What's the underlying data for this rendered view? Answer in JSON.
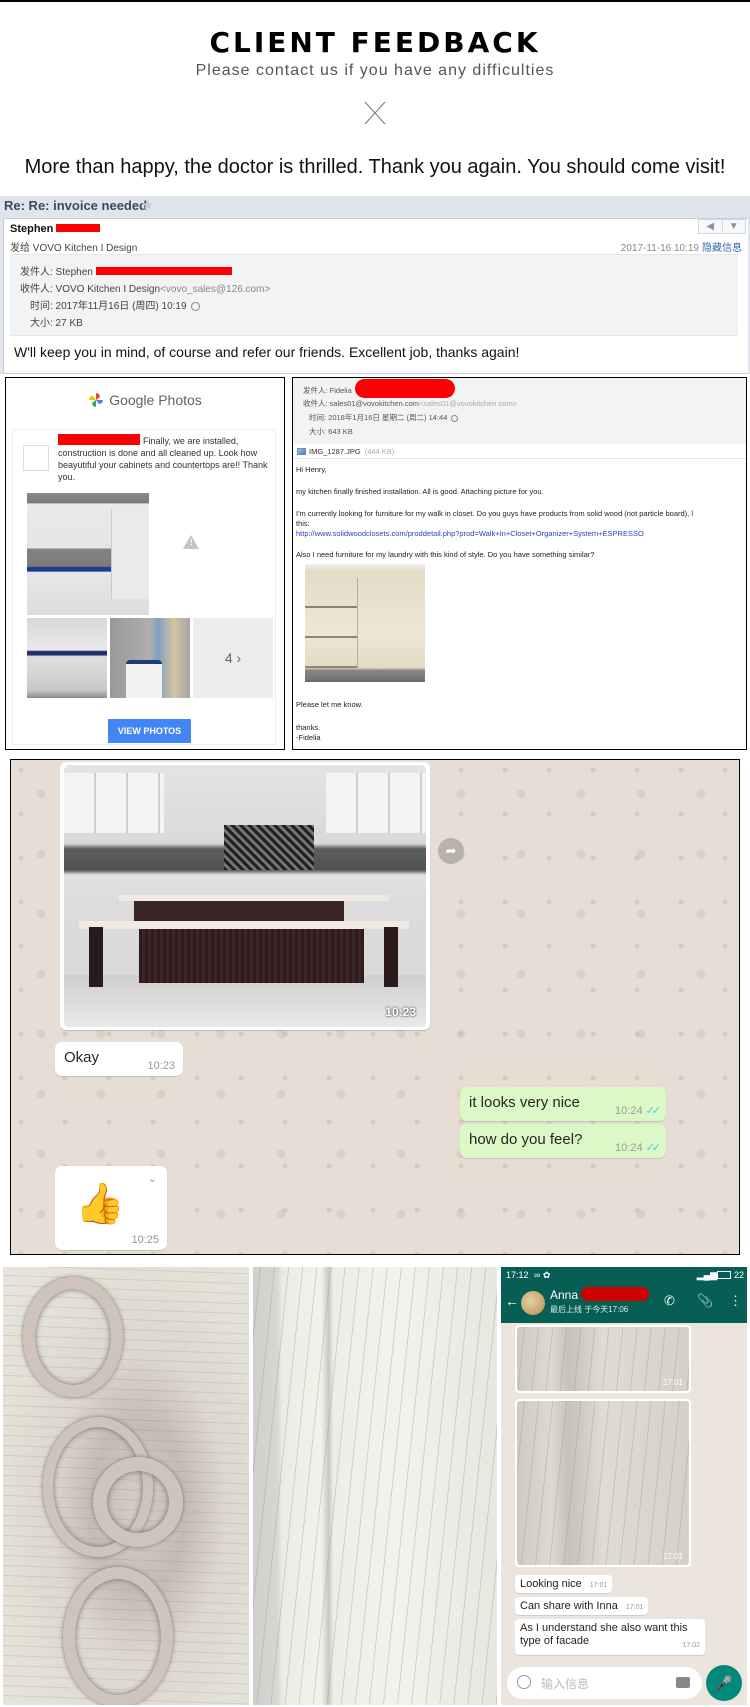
{
  "header": {
    "title": "CLIENT FEEDBACK",
    "subtitle": "Please contact us if you have any difficulties",
    "quote": "More than happy, the doctor is thrilled. Thank you again. You should come visit!"
  },
  "email1": {
    "subject": "Re: Re: invoice needed",
    "sender_name": "Stephen",
    "to_line": "发给 VOVO Kitchen I Design",
    "date": "2017-11-16 10:19",
    "hide_info_link": "隐藏信息",
    "from_label": "发件人: Stephen",
    "recipient_label": "收件人: VOVO Kitchen I Design",
    "recipient_email": "<vovo_sales@126.com>",
    "time_label": "时间: 2017年11月16日 (周四) 10:19",
    "size_label": "大小: 27 KB",
    "body": "W'll keep you in mind, of course and refer our friends.  Excellent job, thanks again!",
    "reply_icon": "reply-icon",
    "more_icon": "dropdown-icon"
  },
  "google_photos": {
    "brand": "Google Photos",
    "message": "Finally, we are installed, construction is done and all cleaned up. Look how beayutiful your cabinets and countertops are!! Thank you.",
    "more_count": "4 ›",
    "button_label": "VIEW PHOTOS"
  },
  "email2": {
    "from_label": "发件人: Fidelia",
    "recipient_label": "收件人: sales01@vovokitchen.com",
    "recipient_email": "<sales01@vovokitchen.com>",
    "time_label": "时间: 2018年1月16日 星期二 (周二) 14:44",
    "size_label": "大小: 643 KB",
    "attachment_name": "IMG_1287.JPG",
    "attachment_size": "(444 KB)",
    "greeting": "Hi Henry,",
    "p1": "my kitchen finally finished installation. All is good. Attaching picture for you.",
    "p2": "I'm currently looking for furniture for my walk in closet. Do you guys have products from solid wood (not particle board), l",
    "p2b": "this:",
    "link": "http://www.solidwoodclosets.com/proddetail.php?prod=Walk+In+Closet+Organizer+System+ESPRESSO",
    "p3": "Also I need furniture for my laundry with this kind of style. Do you have something similar?",
    "p4": "Please let me know.",
    "sign1": "thanks.",
    "sign2": "-Fidelia"
  },
  "whatsapp": {
    "image_time": "10:23",
    "messages": [
      {
        "text": "Okay",
        "time": "10:23",
        "direction": "in"
      },
      {
        "text": "it looks very nice",
        "time": "10:24",
        "direction": "out",
        "read": true
      },
      {
        "text": "how do you feel?",
        "time": "10:24",
        "direction": "out",
        "read": true
      },
      {
        "text": "👍",
        "time": "10:25",
        "direction": "in"
      }
    ]
  },
  "phone_chat": {
    "status_time": "17:12",
    "status_icons": "∞ ✿",
    "battery": "22",
    "contact_name": "Anna",
    "last_seen": "最后上线 于今天17:06",
    "images": [
      {
        "time": "17:01"
      },
      {
        "time": "17:01"
      }
    ],
    "messages": [
      {
        "text": "Looking nice",
        "time": "17:01"
      },
      {
        "text": "Can share with Inna",
        "time": "17:01"
      },
      {
        "text": "As I understand she also want this type of facade",
        "time": "17:02"
      }
    ],
    "input_placeholder": "输入信息"
  }
}
